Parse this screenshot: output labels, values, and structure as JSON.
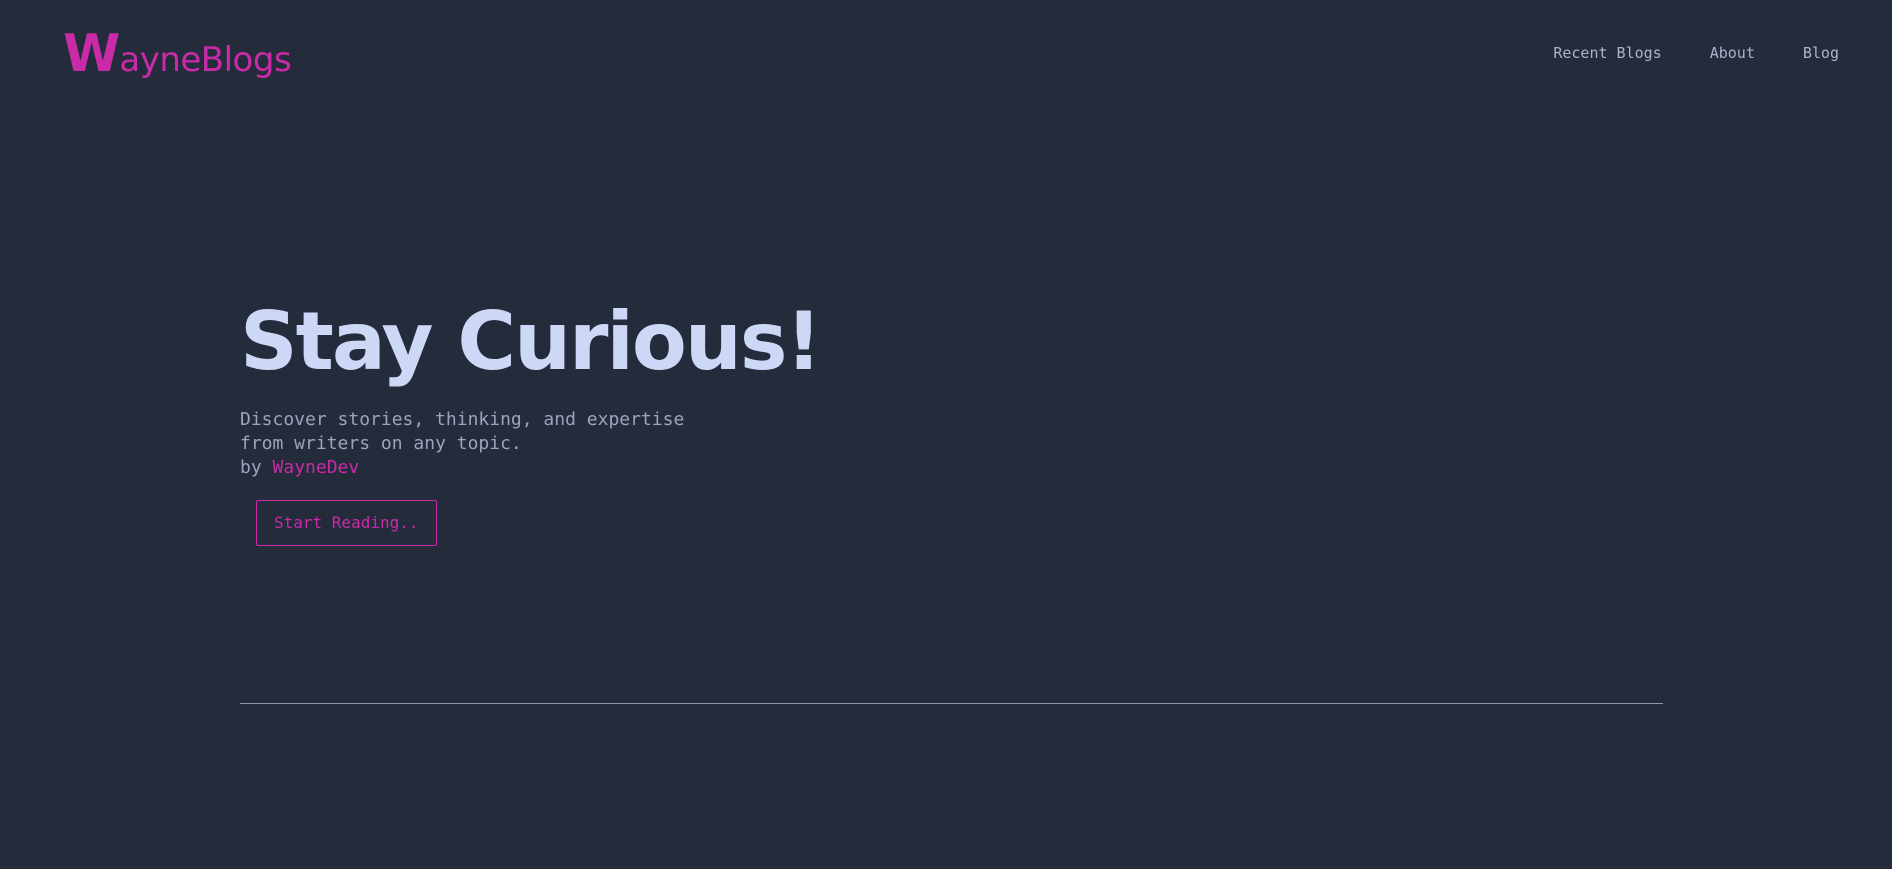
{
  "brand": {
    "initial": "W",
    "rest": "ayneBlogs",
    "color": "#c92aa8"
  },
  "nav": {
    "items": [
      {
        "label": "Recent Blogs"
      },
      {
        "label": "About"
      },
      {
        "label": "Blog"
      }
    ]
  },
  "hero": {
    "title": "Stay Curious!",
    "description_line1": "Discover stories, thinking, and expertise",
    "description_line2": "from writers on any topic.",
    "by_label": "by",
    "author": "WayneDev",
    "cta_label": "Start Reading.."
  },
  "colors": {
    "background": "#242b3a",
    "accent": "#c92aa8",
    "title": "#cdd8f7",
    "body_text": "#9aa5bd",
    "nav_text": "#aab4cc"
  }
}
